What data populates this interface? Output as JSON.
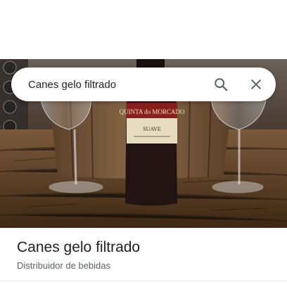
{
  "search": {
    "value": "Canes gelo filtrado",
    "search_icon": "search-icon",
    "close_icon": "close-icon"
  },
  "photo": {
    "bottle_label_brand": "QUINTA do MORCADO",
    "bottle_label_type": "SUAVE"
  },
  "place": {
    "name": "Canes gelo filtrado",
    "category": "Distribuidor de bebidas"
  },
  "colors": {
    "title_text": "#202124",
    "subtitle_text": "#5f6368",
    "icon": "#5f6368"
  }
}
